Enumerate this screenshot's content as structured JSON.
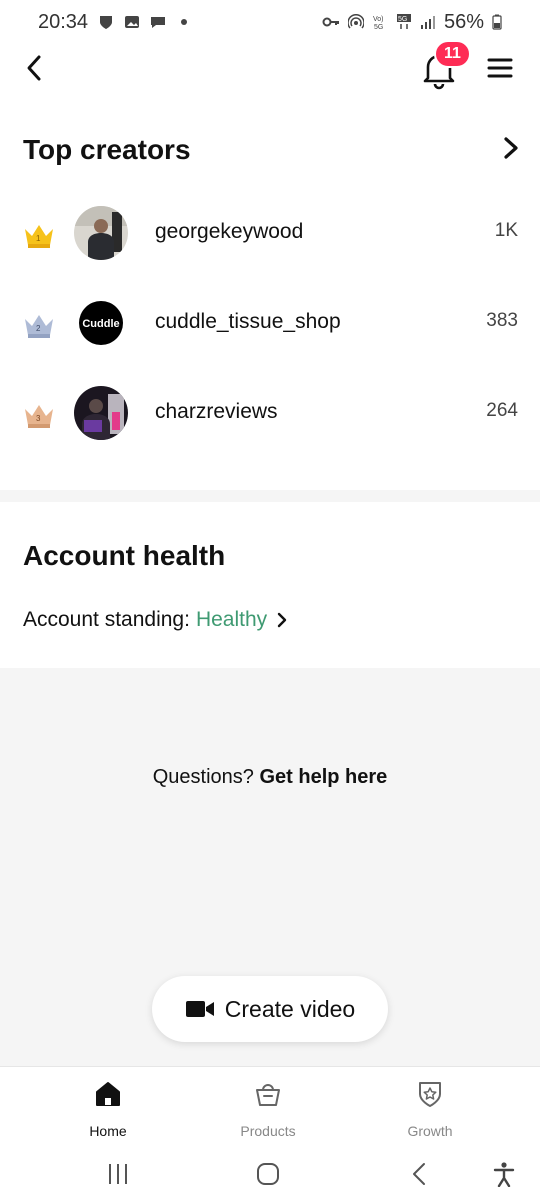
{
  "status_bar": {
    "time": "20:34",
    "battery": "56%"
  },
  "header": {
    "notification_count": "11"
  },
  "top_creators": {
    "title": "Top creators",
    "rows": [
      {
        "rank": "1",
        "name": "georgekeywood",
        "count": "1K",
        "crown_color": "#f6c21a"
      },
      {
        "rank": "2",
        "name": "cuddle_tissue_shop",
        "count": "383",
        "crown_color": "#aebbd6"
      },
      {
        "rank": "3",
        "name": "charzreviews",
        "count": "264",
        "crown_color": "#e7b48e"
      }
    ]
  },
  "account_health": {
    "title": "Account health",
    "standing_label": "Account standing:",
    "standing_value": "Healthy"
  },
  "help": {
    "prefix": "Questions?",
    "link": "Get help here"
  },
  "create_video": {
    "label": "Create video"
  },
  "bottom_nav": {
    "items": [
      {
        "label": "Home",
        "icon": "home-icon",
        "active": true
      },
      {
        "label": "Products",
        "icon": "basket-icon",
        "active": false
      },
      {
        "label": "Growth",
        "icon": "shield-star-icon",
        "active": false
      }
    ]
  },
  "colors": {
    "accent_badge": "#fe2c55",
    "healthy": "#3f9a72"
  }
}
